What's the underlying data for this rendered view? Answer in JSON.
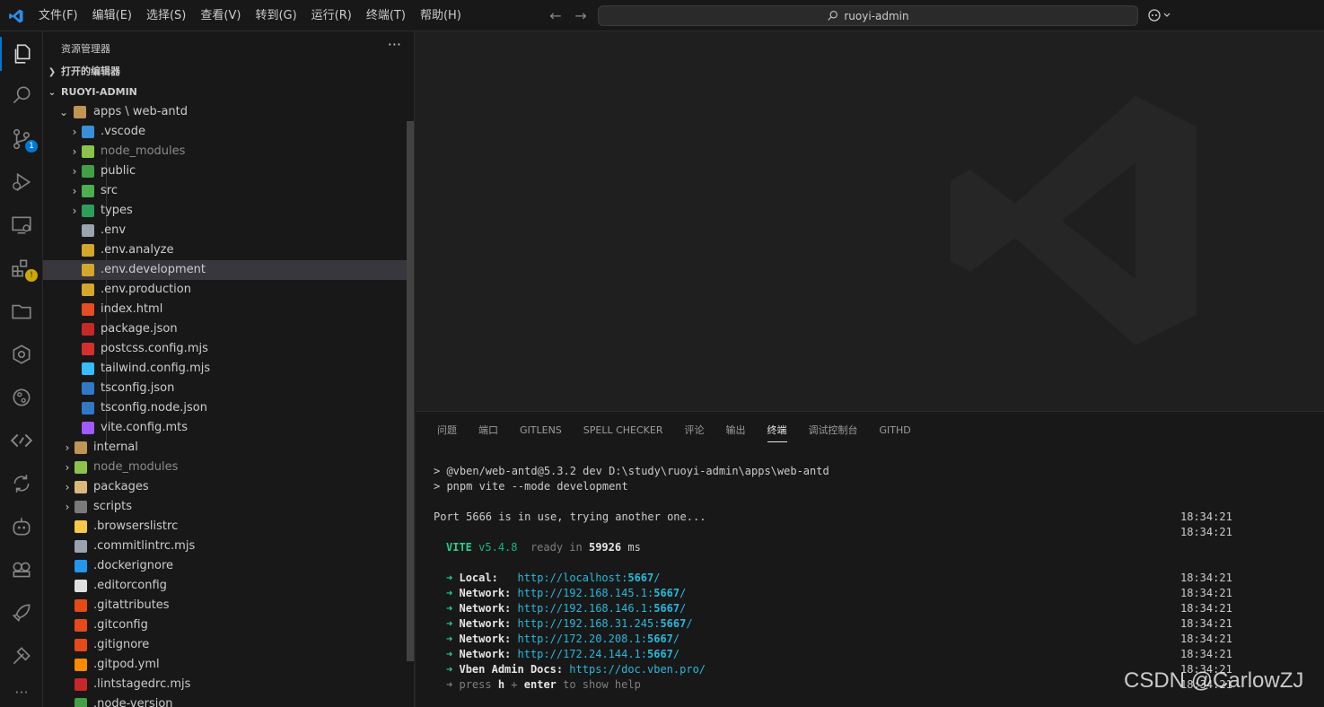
{
  "titlebar": {
    "menu": [
      "文件(F)",
      "编辑(E)",
      "选择(S)",
      "查看(V)",
      "转到(G)",
      "运行(R)",
      "终端(T)",
      "帮助(H)"
    ],
    "search": "ruoyi-admin",
    "back_icon": "arrow-left-icon",
    "forward_icon": "arrow-right-icon"
  },
  "activity_bar": {
    "items": [
      {
        "name": "explorer",
        "icon": "files-icon"
      },
      {
        "name": "search",
        "icon": "search-icon"
      },
      {
        "name": "source-control",
        "icon": "source-control-icon",
        "badge": "1"
      },
      {
        "name": "run-debug",
        "icon": "debug-icon"
      },
      {
        "name": "remote-explorer",
        "icon": "remote-icon"
      },
      {
        "name": "extensions",
        "icon": "extensions-icon",
        "badge": "!"
      },
      {
        "name": "project-manager",
        "icon": "folder-icon"
      },
      {
        "name": "gitlens",
        "icon": "gitlens-icon"
      },
      {
        "name": "git-graph",
        "icon": "git-graph-icon"
      },
      {
        "name": "code-tag",
        "icon": "code-icon"
      },
      {
        "name": "sync",
        "icon": "sync-icon"
      },
      {
        "name": "copilot-bot",
        "icon": "robot-icon"
      },
      {
        "name": "game",
        "icon": "gamepad-icon"
      },
      {
        "name": "deploy",
        "icon": "rocket-icon"
      },
      {
        "name": "tools",
        "icon": "tools-icon"
      },
      {
        "name": "more",
        "icon": "ellipsis-icon"
      }
    ]
  },
  "sidebar": {
    "title": "资源管理器",
    "more": "···",
    "open_editors": "打开的编辑器",
    "root": "RUOYI-ADMIN",
    "folder": "apps \\ web-antd",
    "rows": [
      {
        "label": ".vscode",
        "type": "folder",
        "indent": 1,
        "color": "#3b8ed8"
      },
      {
        "label": "node_modules",
        "type": "folder",
        "indent": 1,
        "color": "#8bc34a",
        "dim": true
      },
      {
        "label": "public",
        "type": "folder",
        "indent": 1,
        "color": "#43a047"
      },
      {
        "label": "src",
        "type": "folder",
        "indent": 1,
        "color": "#4caf50"
      },
      {
        "label": "types",
        "type": "folder",
        "indent": 1,
        "color": "#2e9e5b"
      },
      {
        "label": ".env",
        "type": "file",
        "indent": 1,
        "color": "#9aa4b1"
      },
      {
        "label": ".env.analyze",
        "type": "file",
        "indent": 1,
        "color": "#d4a72c"
      },
      {
        "label": ".env.development",
        "type": "file",
        "indent": 1,
        "color": "#d4a72c",
        "selected": true
      },
      {
        "label": ".env.production",
        "type": "file",
        "indent": 1,
        "color": "#d4a72c"
      },
      {
        "label": "index.html",
        "type": "file",
        "indent": 1,
        "color": "#e44d26"
      },
      {
        "label": "package.json",
        "type": "file",
        "indent": 1,
        "color": "#c62828"
      },
      {
        "label": "postcss.config.mjs",
        "type": "file",
        "indent": 1,
        "color": "#d32f2f"
      },
      {
        "label": "tailwind.config.mjs",
        "type": "file",
        "indent": 1,
        "color": "#38bdf8"
      },
      {
        "label": "tsconfig.json",
        "type": "file",
        "indent": 1,
        "color": "#3178c6"
      },
      {
        "label": "tsconfig.node.json",
        "type": "file",
        "indent": 1,
        "color": "#3178c6"
      },
      {
        "label": "vite.config.mts",
        "type": "file",
        "indent": 1,
        "color": "#a259ff"
      },
      {
        "label": "internal",
        "type": "folder",
        "indent": 0,
        "color": "#c09553"
      },
      {
        "label": "node_modules",
        "type": "folder",
        "indent": 0,
        "color": "#8bc34a",
        "dim": true
      },
      {
        "label": "packages",
        "type": "folder",
        "indent": 0,
        "color": "#dcb67a"
      },
      {
        "label": "scripts",
        "type": "folder",
        "indent": 0,
        "color": "#7a7a7a"
      },
      {
        "label": ".browserslistrc",
        "type": "file",
        "indent": 0,
        "color": "#f7c948"
      },
      {
        "label": ".commitlintrc.mjs",
        "type": "file",
        "indent": 0,
        "color": "#9aa4b1"
      },
      {
        "label": ".dockerignore",
        "type": "file",
        "indent": 0,
        "color": "#2496ed"
      },
      {
        "label": ".editorconfig",
        "type": "file",
        "indent": 0,
        "color": "#e0e0e0"
      },
      {
        "label": ".gitattributes",
        "type": "file",
        "indent": 0,
        "color": "#e64a19"
      },
      {
        "label": ".gitconfig",
        "type": "file",
        "indent": 0,
        "color": "#e64a19"
      },
      {
        "label": ".gitignore",
        "type": "file",
        "indent": 0,
        "color": "#e64a19"
      },
      {
        "label": ".gitpod.yml",
        "type": "file",
        "indent": 0,
        "color": "#ff8a00"
      },
      {
        "label": ".lintstagedrc.mjs",
        "type": "file",
        "indent": 0,
        "color": "#c62828"
      },
      {
        "label": ".node-version",
        "type": "file",
        "indent": 0,
        "color": "#43a047"
      }
    ]
  },
  "panel": {
    "tabs": [
      "问题",
      "端口",
      "GITLENS",
      "SPELL CHECKER",
      "评论",
      "输出",
      "终端",
      "调试控制台",
      "GITHD"
    ],
    "active_tab": "终端"
  },
  "terminal": {
    "lines": [
      {
        "text": "> @vben/web-antd@5.3.2 dev D:\\study\\ruoyi-admin\\apps\\web-antd"
      },
      {
        "text": "> pnpm vite --mode development"
      },
      {
        "text": ""
      },
      {
        "text": "Port 5666 is in use, trying another one...",
        "time": "18:34:21"
      },
      {
        "text": "",
        "time": "18:34:21"
      },
      {
        "vite": "VITE",
        "version": "v5.4.8",
        "ready": "ready in",
        "ms": "59926",
        "ms_unit": "ms"
      },
      {
        "text": ""
      },
      {
        "arrow": "➜",
        "label": "Local:",
        "url_pre": "http://localhost:",
        "port": "5667",
        "url_post": "/",
        "time": "18:34:21"
      },
      {
        "arrow": "➜",
        "label": "Network:",
        "url_pre": "http://192.168.145.1:",
        "port": "5667",
        "url_post": "/",
        "time": "18:34:21"
      },
      {
        "arrow": "➜",
        "label": "Network:",
        "url_pre": "http://192.168.146.1:",
        "port": "5667",
        "url_post": "/",
        "time": "18:34:21"
      },
      {
        "arrow": "➜",
        "label": "Network:",
        "url_pre": "http://192.168.31.245:",
        "port": "5667",
        "url_post": "/",
        "time": "18:34:21"
      },
      {
        "arrow": "➜",
        "label": "Network:",
        "url_pre": "http://172.20.208.1:",
        "port": "5667",
        "url_post": "/",
        "time": "18:34:21"
      },
      {
        "arrow": "➜",
        "label": "Network:",
        "url_pre": "http://172.24.144.1:",
        "port": "5667",
        "url_post": "/",
        "time": "18:34:21"
      },
      {
        "arrow": "➜",
        "label": "Vben Admin Docs:",
        "url_pre": "https://doc.vben.pro/",
        "port": "",
        "url_post": "",
        "time": "18:34:21"
      },
      {
        "arrow": "➜",
        "press": "press",
        "key1": "h",
        "plus": "+",
        "key2": "enter",
        "tail": "to show help",
        "time": "18:34:21"
      }
    ]
  },
  "watermark": "CSDN @CarlowZJ"
}
